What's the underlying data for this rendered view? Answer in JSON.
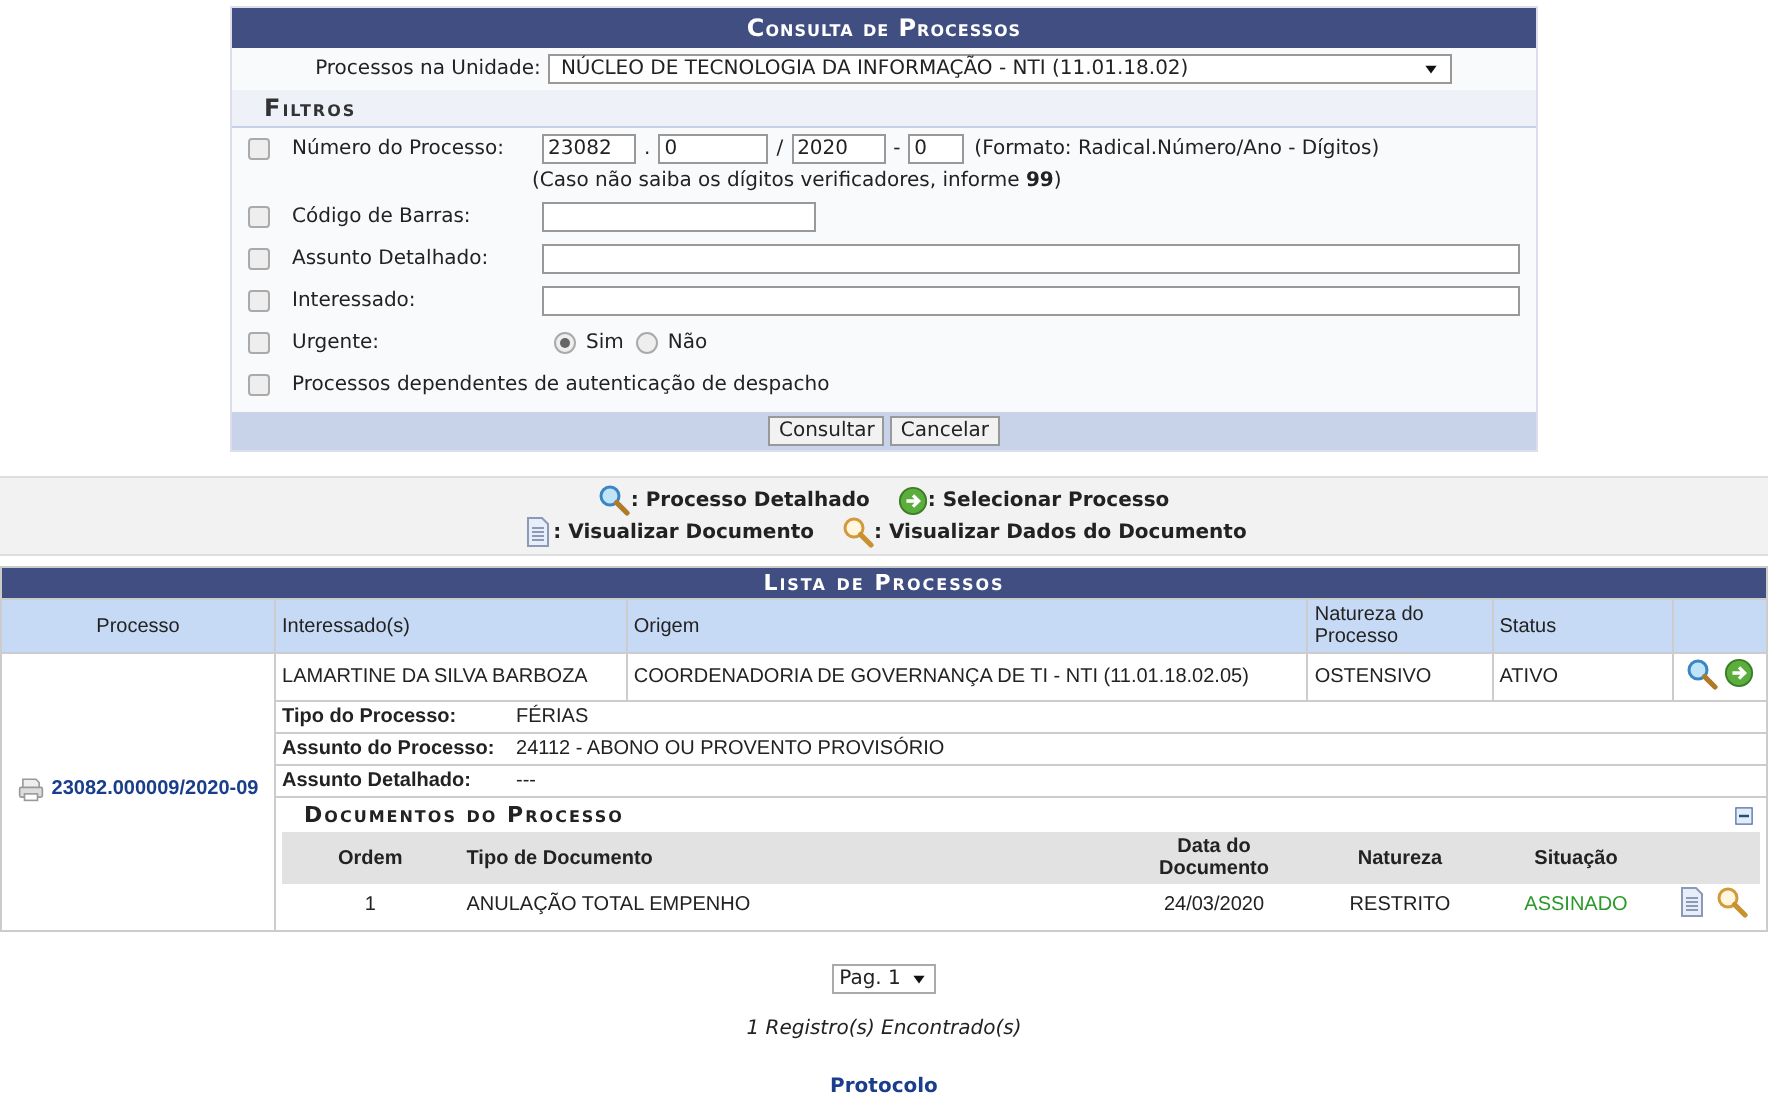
{
  "search_form": {
    "title": "Consulta de Processos",
    "unit": {
      "label": "Processos na Unidade:",
      "value": "NÚCLEO DE TECNOLOGIA DA INFORMAÇÃO - NTI (11.01.18.02)"
    },
    "filters_title": "Filtros",
    "filters": [
      {
        "kind": "process_number",
        "checked": false,
        "label": "Número do Processo:",
        "parts": [
          {
            "value": "23082"
          },
          {
            "separator": ".",
            "value": "0"
          },
          {
            "separator": "/",
            "value": "2020"
          },
          {
            "separator": "-",
            "value": "0"
          }
        ],
        "hint": "(Formato: Radical.Número/Ano - Dígitos)",
        "note": "(Caso não saiba os dígitos verificadores, informe **99**)"
      },
      {
        "kind": "short_text",
        "checked": false,
        "label": "Código de Barras:"
      },
      {
        "kind": "text",
        "checked": false,
        "label": "Assunto Detalhado:"
      },
      {
        "kind": "text",
        "checked": false,
        "label": "Interessado:"
      },
      {
        "kind": "radio",
        "checked": false,
        "label": "Urgente:",
        "options": [
          {
            "label": "Sim",
            "selected": true
          },
          {
            "label": "Não",
            "selected": false
          }
        ]
      },
      {
        "kind": "flag",
        "checked": false,
        "label": "Processos dependentes de autenticação de despacho"
      }
    ],
    "buttons": [
      "Consultar",
      "Cancelar"
    ]
  },
  "legend": [
    [
      {
        "kind": "magnifier",
        "label": ": Processo Detalhado"
      },
      {
        "kind": "select",
        "label": ": Selecionar Processo"
      }
    ],
    [
      {
        "kind": "document",
        "label": ": Visualizar Documento"
      },
      {
        "kind": "doc_magnifier",
        "label": ": Visualizar Dados do Documento"
      }
    ]
  ],
  "list": {
    "title": "Lista de Processos",
    "columns": [
      "Processo",
      "Interessado(s)",
      "Origem",
      "Natureza do Processo",
      "Status"
    ],
    "rows": [
      {
        "process": "23082.000009/2020-09",
        "interested": "LAMARTINE DA SILVA BARBOZA",
        "origin": "COORDENADORIA DE GOVERNANÇA DE TI - NTI (11.01.18.02.05)",
        "nature": "OSTENSIVO",
        "status": "ATIVO",
        "details": [
          {
            "label": "Tipo do Processo:",
            "value": "FÉRIAS"
          },
          {
            "label": "Assunto do Processo:",
            "value": "24112 - ABONO OU PROVENTO PROVISÓRIO"
          },
          {
            "label": "Assunto Detalhado:",
            "value": "---"
          }
        ],
        "documents": {
          "title": "Documentos do Processo",
          "expanded": true,
          "columns": [
            "Ordem",
            "Tipo de Documento",
            "Data do Documento",
            "Natureza",
            "Situação"
          ],
          "rows": [
            {
              "order": "1",
              "type": "ANULAÇÃO TOTAL EMPENHO",
              "date": "24/03/2020",
              "nature": "RESTRITO",
              "status": "ASSINADO"
            }
          ]
        }
      }
    ]
  },
  "pagination": {
    "value": "Pag. 1"
  },
  "records": "1 Registro(s) Encontrado(s)",
  "footer_link": "Protocolo"
}
